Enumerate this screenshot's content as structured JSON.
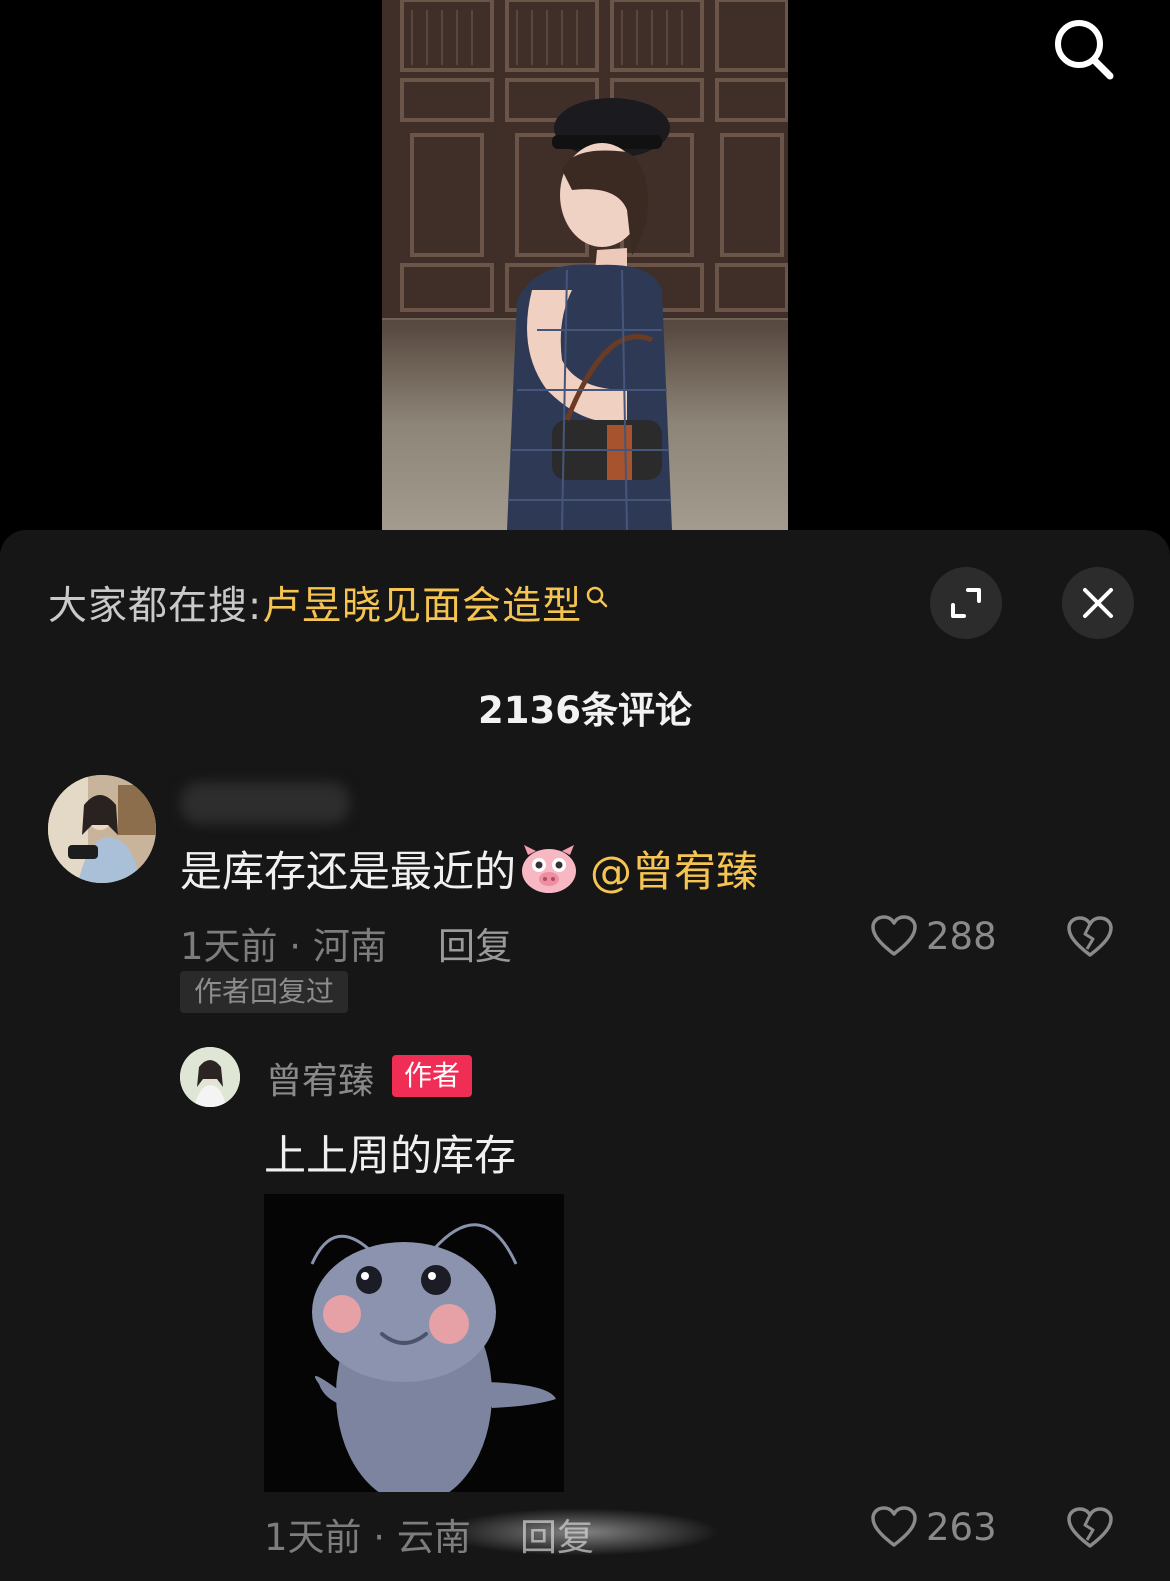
{
  "video": {
    "description_icon": "search-icon"
  },
  "sheet": {
    "trending_prefix": "大家都在搜:",
    "trending_term": "卢昱晓见面会造型",
    "expand_icon": "expand-icon",
    "close_icon": "close-icon",
    "comment_count": "2136条评论"
  },
  "comments": [
    {
      "text": "是库存还是最近的",
      "emoji": "pig-face-icon",
      "mention": "@曾宥臻",
      "meta": "1天前 · 河南",
      "reply_label": "回复",
      "likes": "288",
      "author_replied_badge": "作者回复过",
      "reply": {
        "author": "曾宥臻",
        "author_tag": "作者",
        "text": "上上周的库存",
        "sticker": "ant-sticker",
        "meta": "1天前 · 云南",
        "reply_label": "回复",
        "likes": "263"
      }
    }
  ],
  "colors": {
    "sheet_bg": "#161616",
    "accent_yellow": "#f5c451",
    "author_tag_red": "#f02d55"
  }
}
